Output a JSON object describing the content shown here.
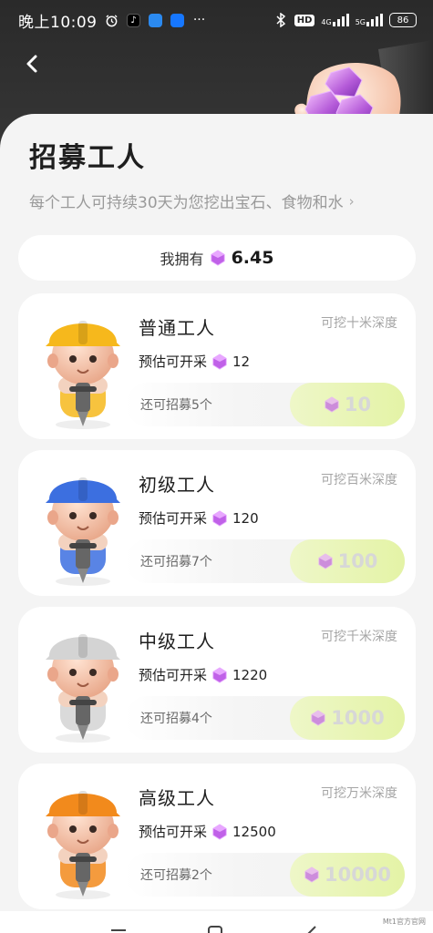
{
  "status_bar": {
    "time": "晚上10:09",
    "network_badge": "HD",
    "signal1_label": "4G",
    "signal2_label": "5G",
    "battery": "86"
  },
  "header": {
    "title": "招募工人",
    "subtitle": "每个工人可持续30天为您挖出宝石、食物和水",
    "subtitle_chevron": "›"
  },
  "balance": {
    "label": "我拥有",
    "value": "6.45"
  },
  "workers": [
    {
      "name": "普通工人",
      "depth": "可挖十米深度",
      "estimate_label": "预估可开采",
      "estimate_value": "12",
      "remaining": "还可招募5个",
      "price": "10",
      "helmet_color": "#f6b81c"
    },
    {
      "name": "初级工人",
      "depth": "可挖百米深度",
      "estimate_label": "预估可开采",
      "estimate_value": "120",
      "remaining": "还可招募7个",
      "price": "100",
      "helmet_color": "#3c6fe0"
    },
    {
      "name": "中级工人",
      "depth": "可挖千米深度",
      "estimate_label": "预估可开采",
      "estimate_value": "1220",
      "remaining": "还可招募4个",
      "price": "1000",
      "helmet_color": "#d4d4d4"
    },
    {
      "name": "高级工人",
      "depth": "可挖万米深度",
      "estimate_label": "预估可开采",
      "estimate_value": "12500",
      "remaining": "还可招募2个",
      "price": "10000",
      "helmet_color": "#f28a1c"
    }
  ],
  "watermark": "Mt1官方官网",
  "colors": {
    "gem": "#c061e8",
    "recruit_button": "#e4f3a6",
    "sheet_bg": "#f4f4f4",
    "header_bg": "#2a2a2a"
  }
}
